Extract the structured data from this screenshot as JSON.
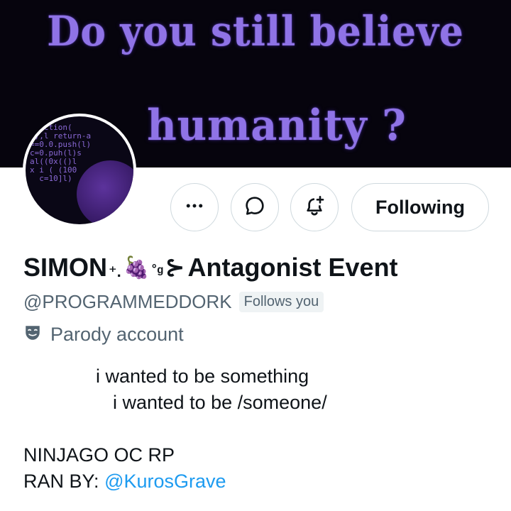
{
  "banner": {
    "line1": "Do you still believe",
    "line2": "humanity ?"
  },
  "avatar": {
    "code_text": "function(\ni),l return-a\n==0.0.push(l)\nc=0.puh(l)s\nal((0x(()l\nx i ( (100\n  c=10]l)"
  },
  "actions": {
    "more_icon": "more-icon",
    "message_icon": "message-icon",
    "notify_icon": "bell-plus-icon",
    "following_label": "Following"
  },
  "profile": {
    "name_start": "SIMON",
    "name_deco_left": "⁺.",
    "grape": "🍇",
    "name_deco_right": "˚ᵍ",
    "name_end": "Antagonist Event",
    "handle": "@PROGRAMMEDDORK",
    "follows_badge": "Follows you",
    "parody_label": "Parody account"
  },
  "bio": {
    "line1": "i wanted to be something",
    "line2": "i wanted to be /someone/",
    "line3": "NINJAGO OC RP",
    "line4_prefix": "RAN BY:",
    "line4_mention": "@KurosGrave"
  },
  "colors": {
    "banner_text": "#8f73e6",
    "secondary_text": "#536471",
    "link": "#1d9bf0",
    "border": "#cfd9de"
  }
}
